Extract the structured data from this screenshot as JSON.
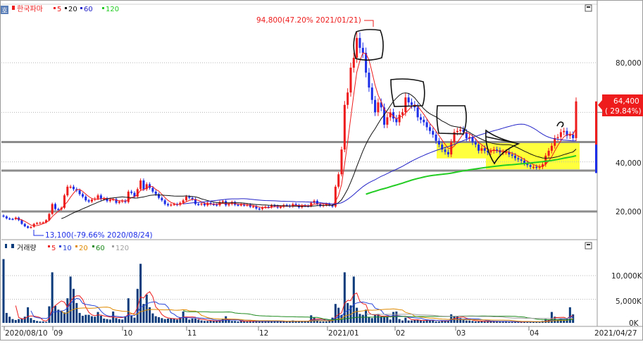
{
  "colors": {
    "up": "#ee1c1c",
    "down": "#1c2ee8",
    "ma5": "#ee1c1c",
    "ma20": "#111111",
    "ma60": "#2323c8",
    "ma120": "#22cc22",
    "vol_ma5": "#ee1c1c",
    "vol_ma10": "#2b46d8",
    "vol_ma20": "#e08a00",
    "vol_ma60": "#1e8a1e",
    "vol_ma120": "#a0a0a0",
    "bars": "#0c3c7c",
    "highlight": "#ffff33",
    "hline": "#8c8c8c"
  },
  "side_icon": "호",
  "price_panel": {
    "legend": {
      "name": "한국파마",
      "ma_labels": [
        "5",
        "20",
        "60",
        "120"
      ]
    },
    "ticks": [
      "80,000",
      "60,000",
      "40,000",
      "20,000"
    ],
    "max_annotation": "94,800(47.20% 2021/01/21)",
    "min_annotation": "13,100(-79.66% 2020/08/24)",
    "last_price": "64,400",
    "last_change": "( 29.84%)"
  },
  "volume_panel": {
    "legend": {
      "name": "거래량",
      "ma_labels": [
        "5",
        "10",
        "20",
        "60",
        "120"
      ]
    },
    "ticks": [
      "10,000K",
      "5,000K",
      "0K"
    ]
  },
  "x_axis": {
    "labels": [
      "2020/08/10",
      "09",
      "10",
      "11",
      "12",
      "2021/01",
      "02",
      "03",
      "04",
      "2021/04/27"
    ]
  },
  "chart_data": {
    "type": "candlestick",
    "title": "한국파마",
    "ylim": [
      8000,
      100000
    ],
    "volume_ylim": [
      0,
      14500
    ],
    "volume_unit": "K",
    "start_date": "2020/08/10",
    "end_date": "2021/04/27",
    "horizontal_lines": [
      48000,
      36500,
      20000
    ],
    "highlight_band": [
      37000,
      48000
    ],
    "ma_periods": [
      5,
      20,
      60,
      120
    ],
    "closes": [
      18000,
      17200,
      17000,
      16900,
      17500,
      16500,
      15000,
      14000,
      13400,
      13800,
      15000,
      15400,
      15500,
      15600,
      16500,
      19000,
      23000,
      21000,
      20800,
      21500,
      26500,
      30000,
      30000,
      29000,
      28500,
      27000,
      26000,
      24500,
      24000,
      24800,
      25200,
      26500,
      25000,
      25300,
      24200,
      24800,
      25000,
      23500,
      24000,
      24400,
      23800,
      28000,
      27500,
      26000,
      29000,
      32500,
      29000,
      31000,
      29500,
      28000,
      27000,
      25500,
      24500,
      23000,
      22500,
      22800,
      23000,
      22700,
      23500,
      24500,
      26000,
      25500,
      25000,
      23000,
      22800,
      23200,
      22500,
      23500,
      23000,
      22800,
      22500,
      23800,
      24200,
      22500,
      23000,
      23800,
      22700,
      22600,
      22800,
      22500,
      22800,
      21900,
      22100,
      21200,
      21000,
      21600,
      21900,
      21700,
      22500,
      22200,
      21600,
      21900,
      22600,
      22400,
      22000,
      23000,
      22600,
      21700,
      22500,
      22300,
      22200,
      23500,
      24300,
      23000,
      22200,
      22600,
      23000,
      22600,
      22000,
      30000,
      35000,
      45000,
      63000,
      68000,
      78000,
      82000,
      90000,
      86000,
      84000,
      76000,
      70000,
      65000,
      60000,
      64000,
      62000,
      55000,
      58000,
      60000,
      57500,
      56000,
      59000,
      60000,
      66000,
      64000,
      63000,
      62000,
      58000,
      57000,
      56000,
      54000,
      52500,
      51000,
      48500,
      47000,
      45000,
      44000,
      43000,
      48000,
      52000,
      52500,
      53000,
      52000,
      49500,
      50000,
      48000,
      47000,
      44500,
      45500,
      44500,
      43800,
      44400,
      45000,
      44700,
      43800,
      44000,
      44000,
      43000,
      42500,
      41500,
      41000,
      40500,
      39500,
      38700,
      38000,
      38000,
      37800,
      38000,
      39000,
      42500,
      44500,
      46500,
      49600,
      50000,
      52000,
      52500,
      50500,
      51000,
      49600,
      64400
    ],
    "volumes": [
      13500,
      2100,
      1300,
      800,
      600,
      800,
      900,
      1300,
      3300,
      1000,
      600,
      400,
      300,
      300,
      200,
      3500,
      10700,
      3600,
      2800,
      2600,
      2200,
      5200,
      9800,
      7200,
      4200,
      2100,
      1500,
      1700,
      1700,
      1400,
      1300,
      2300,
      1500,
      900,
      800,
      700,
      2400,
      1000,
      800,
      700,
      1400,
      5200,
      1500,
      1100,
      7200,
      12500,
      4000,
      6000,
      3300,
      2000,
      1400,
      1200,
      1000,
      800,
      900,
      900,
      900,
      700,
      1200,
      2400,
      1100,
      700,
      900,
      900,
      700,
      500,
      400,
      400,
      500,
      400,
      400,
      500,
      900,
      1400,
      600,
      400,
      400,
      300,
      400,
      300,
      300,
      400,
      300,
      300,
      300,
      300,
      400,
      400,
      300,
      400,
      300,
      300,
      300,
      300,
      400,
      500,
      300,
      300,
      300,
      400,
      400,
      1600,
      1100,
      600,
      300,
      300,
      300,
      500,
      1100,
      4000,
      3200,
      1700,
      10700,
      4200,
      3700,
      9800,
      3200,
      1900,
      1700,
      2800,
      1200,
      1000,
      1700,
      1900,
      1300,
      1200,
      1200,
      700,
      2300,
      2400,
      800,
      500,
      1100,
      500,
      500,
      600,
      600,
      500,
      400,
      700,
      500,
      600,
      300,
      300,
      400,
      500,
      400,
      1800,
      1400,
      1400,
      1000,
      600,
      500,
      500,
      400,
      300,
      300,
      400,
      300,
      300,
      300,
      300,
      300,
      300,
      300,
      300,
      200,
      200,
      200,
      200,
      200,
      300,
      300,
      200,
      200,
      200,
      200,
      400,
      800,
      600,
      2300,
      1300,
      700,
      900,
      700,
      1000,
      3300,
      1800
    ]
  }
}
